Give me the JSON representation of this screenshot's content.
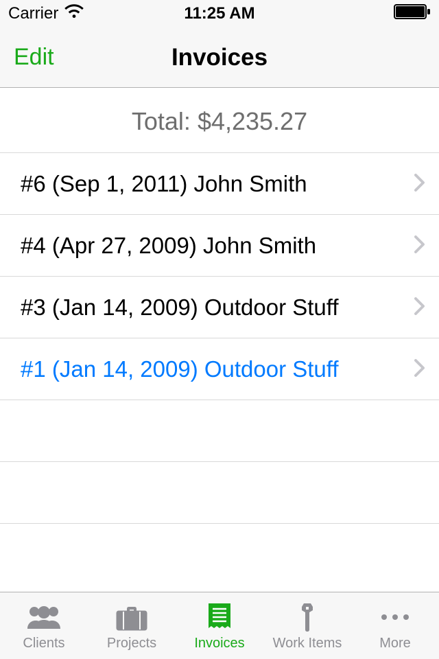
{
  "status_bar": {
    "carrier": "Carrier",
    "time": "11:25 AM"
  },
  "nav": {
    "edit_label": "Edit",
    "title": "Invoices"
  },
  "total": {
    "label": "Total: $4,235.27"
  },
  "invoices": [
    {
      "label": "#6 (Sep 1, 2011) John Smith",
      "highlight": false
    },
    {
      "label": "#4 (Apr 27, 2009) John Smith",
      "highlight": false
    },
    {
      "label": "#3 (Jan 14, 2009) Outdoor Stuff",
      "highlight": false
    },
    {
      "label": "#1 (Jan 14, 2009) Outdoor Stuff",
      "highlight": true
    }
  ],
  "tabs": [
    {
      "label": "Clients",
      "icon": "clients-icon",
      "active": false
    },
    {
      "label": "Projects",
      "icon": "projects-icon",
      "active": false
    },
    {
      "label": "Invoices",
      "icon": "invoices-icon",
      "active": true
    },
    {
      "label": "Work Items",
      "icon": "workitems-icon",
      "active": false
    },
    {
      "label": "More",
      "icon": "more-icon",
      "active": false
    }
  ],
  "colors": {
    "accent": "#1aaa1a",
    "link": "#007aff",
    "gray_text": "#8e8e93"
  }
}
